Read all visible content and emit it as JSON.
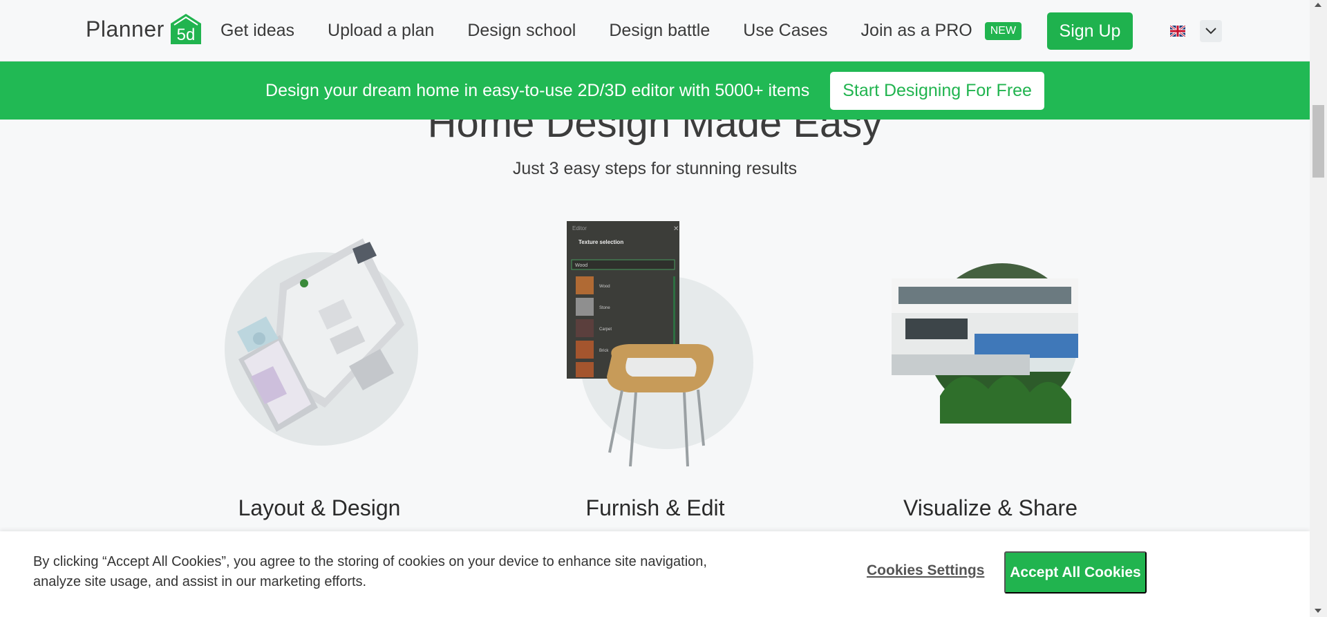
{
  "header": {
    "logo_text": "Planner",
    "logo_badge": "5d",
    "nav": [
      "Get ideas",
      "Upload a plan",
      "Design school",
      "Design battle",
      "Use Cases"
    ],
    "pro_link": "Join as a PRO",
    "pro_badge": "NEW",
    "signup": "Sign Up",
    "language_icon": "uk-flag-icon",
    "lang_toggle_icon": "chevron-down-icon"
  },
  "promo": {
    "text": "Design your dream home in easy-to-use 2D/3D editor with 5000+ items",
    "button": "Start Designing For Free"
  },
  "hero": {
    "title": "Home Design Made Easy",
    "subtitle": "Just 3 easy steps for stunning results"
  },
  "steps": [
    {
      "title": "Layout & Design",
      "image": "floorplan-3d-image"
    },
    {
      "title": "Furnish & Edit",
      "image": "furniture-editor-image",
      "editor_panel": {
        "title": "Editor",
        "heading": "Texture selection",
        "category": "Wood",
        "items": [
          "Wood",
          "Stone",
          "Carpet",
          "Brick"
        ]
      }
    },
    {
      "title": "Visualize & Share",
      "image": "villa-render-image"
    }
  ],
  "cookie": {
    "text": "By clicking “Accept All Cookies”, you agree to the storing of cookies on your device to enhance site navigation, analyze site usage, and assist in our marketing efforts.",
    "settings": "Cookies Settings",
    "accept": "Accept All Cookies"
  },
  "colors": {
    "brand_green": "#21b44f",
    "promo_green": "#21b954"
  }
}
